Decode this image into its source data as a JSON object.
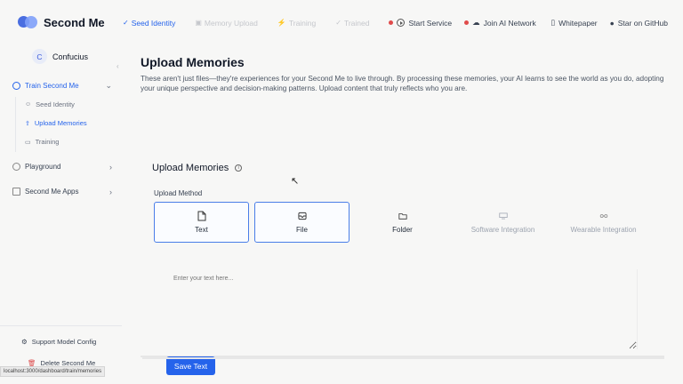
{
  "app": {
    "name": "Second Me"
  },
  "steps": [
    {
      "label": "Seed Identity",
      "icon": "sprout-icon",
      "state": "active"
    },
    {
      "label": "Memory Upload",
      "icon": "upload-icon",
      "state": "inactive"
    },
    {
      "label": "Training",
      "icon": "bolt-icon",
      "state": "inactive"
    },
    {
      "label": "Trained",
      "icon": "check-icon",
      "state": "inactive"
    }
  ],
  "services": [
    {
      "label": "Start Service",
      "status_color": "#e04b4b"
    },
    {
      "label": "Join AI Network",
      "status_color": "#e04b4b"
    }
  ],
  "links": {
    "whitepaper": "Whitepaper",
    "github": "Star on GitHub"
  },
  "sidebar": {
    "user": {
      "initial": "C",
      "name": "Confucius"
    },
    "nav": {
      "train": "Train Second Me",
      "playground": "Playground",
      "apps": "Second Me Apps"
    },
    "sub": {
      "seed": "Seed Identity",
      "upload": "Upload Memories",
      "training": "Training"
    },
    "support": "Support Model Config",
    "delete": "Delete Second Me",
    "url": "localhost:3000/dashboard/train/memories"
  },
  "main": {
    "title": "Upload Memories",
    "description": "These aren't just files—they're experiences for your Second Me to live through. By processing these memories, your AI learns to see the world as you do, adopting your unique perspective and decision-making patterns. Upload content that truly reflects who you are.",
    "card_title": "Upload Memories",
    "method_label": "Upload Method",
    "methods": {
      "text": "Text",
      "file": "File",
      "folder": "Folder",
      "software": "Software Integration",
      "wearable": "Wearable Integration"
    },
    "text_placeholder": "Enter your text here...",
    "save_label": "Save Text"
  },
  "colors": {
    "accent": "#2563eb",
    "status": "#e04b4b"
  }
}
